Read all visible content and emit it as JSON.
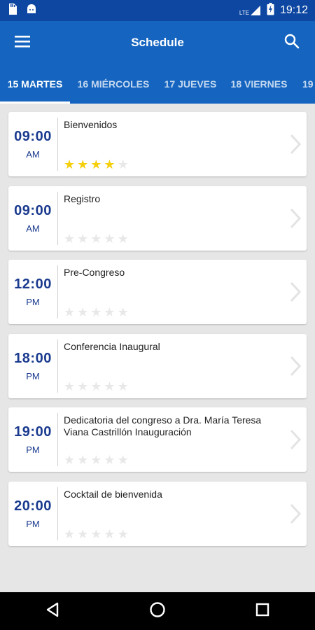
{
  "status_bar": {
    "time": "19:12",
    "network": "LTE",
    "icons": [
      "storage-icon",
      "android-icon",
      "signal-icon",
      "battery-charging-icon"
    ]
  },
  "app_bar": {
    "title": "Schedule",
    "menu_icon": "menu-icon",
    "search_icon": "search-icon"
  },
  "tabs": [
    {
      "label": "15 MARTES",
      "active": true
    },
    {
      "label": "16 MIÉRCOLES",
      "active": false
    },
    {
      "label": "17 JUEVES",
      "active": false
    },
    {
      "label": "18 VIERNES",
      "active": false
    },
    {
      "label": "19",
      "active": false
    }
  ],
  "schedule": [
    {
      "time": "09:00",
      "period": "AM",
      "title": "Bienvenidos",
      "rating": 4,
      "max_rating": 5
    },
    {
      "time": "09:00",
      "period": "AM",
      "title": "Registro",
      "rating": 0,
      "max_rating": 5
    },
    {
      "time": "12:00",
      "period": "PM",
      "title": "Pre-Congreso",
      "rating": 0,
      "max_rating": 5
    },
    {
      "time": "18:00",
      "period": "PM",
      "title": "Conferencia Inaugural",
      "rating": 0,
      "max_rating": 5
    },
    {
      "time": "19:00",
      "period": "PM",
      "title": "Dedicatoria del congreso a Dra. María Teresa Viana Castrillón Inauguración",
      "rating": 0,
      "max_rating": 5
    },
    {
      "time": "20:00",
      "period": "PM",
      "title": "Cocktail de bienvenida",
      "rating": 0,
      "max_rating": 5
    }
  ],
  "nav_bar": {
    "buttons": [
      "back-icon",
      "home-icon",
      "recents-icon"
    ]
  },
  "colors": {
    "app_bar": "#1565c0",
    "status_bar": "#0d47a1",
    "time_text": "#1a3a8f",
    "star_on": "#f4cf0a",
    "star_off": "#e8e8e8",
    "background": "#e6e6e6"
  }
}
